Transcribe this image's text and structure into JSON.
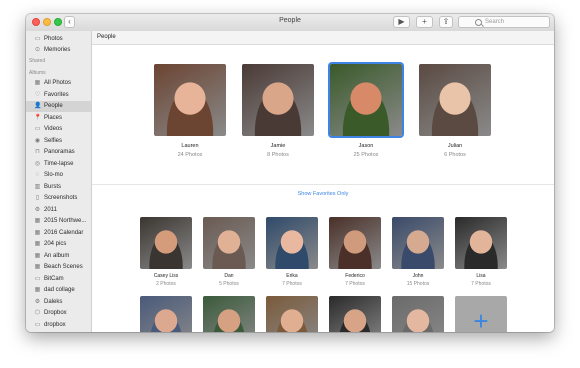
{
  "window": {
    "title": "People"
  },
  "toolbar": {
    "back": "‹",
    "play": "▶",
    "add": "+",
    "share": "⇪",
    "search_placeholder": "Search"
  },
  "sidebar": {
    "top": [
      {
        "label": "Photos",
        "icon": "photos-icon",
        "glyph": "▭"
      },
      {
        "label": "Memories",
        "icon": "memories-icon",
        "glyph": "⊙"
      }
    ],
    "shared_heading": "Shared",
    "albums_heading": "Albums",
    "albums": [
      {
        "label": "All Photos",
        "icon": "album-icon",
        "glyph": "▦"
      },
      {
        "label": "Favorites",
        "icon": "heart-icon",
        "glyph": "♡"
      },
      {
        "label": "People",
        "icon": "person-icon",
        "glyph": "👤",
        "selected": true
      },
      {
        "label": "Places",
        "icon": "pin-icon",
        "glyph": "📍"
      },
      {
        "label": "Videos",
        "icon": "video-icon",
        "glyph": "▭"
      },
      {
        "label": "Selfies",
        "icon": "selfie-icon",
        "glyph": "◉"
      },
      {
        "label": "Panoramas",
        "icon": "panorama-icon",
        "glyph": "⊓"
      },
      {
        "label": "Time-lapse",
        "icon": "timelapse-icon",
        "glyph": "◎"
      },
      {
        "label": "Slo-mo",
        "icon": "slomo-icon",
        "glyph": "◌"
      },
      {
        "label": "Bursts",
        "icon": "bursts-icon",
        "glyph": "▥"
      },
      {
        "label": "Screenshots",
        "icon": "screenshot-icon",
        "glyph": "▯"
      },
      {
        "label": "2011",
        "icon": "album-icon",
        "glyph": "⚙"
      },
      {
        "label": "2015 Northwe...",
        "icon": "album-icon",
        "glyph": "▦"
      },
      {
        "label": "2016 Calendar",
        "icon": "album-icon",
        "glyph": "▦"
      },
      {
        "label": "204 pics",
        "icon": "album-icon",
        "glyph": "▦"
      },
      {
        "label": "An album",
        "icon": "album-icon",
        "glyph": "▦"
      },
      {
        "label": "Beach Scenes",
        "icon": "album-icon",
        "glyph": "▦"
      },
      {
        "label": "BitCam",
        "icon": "album-icon",
        "glyph": "▭"
      },
      {
        "label": "dad collage",
        "icon": "album-icon",
        "glyph": "▦"
      },
      {
        "label": "Daleks",
        "icon": "album-icon",
        "glyph": "⚙"
      },
      {
        "label": "Dropbox",
        "icon": "dropbox-icon",
        "glyph": "⬡"
      },
      {
        "label": "dropbox",
        "icon": "album-icon",
        "glyph": "▭"
      }
    ]
  },
  "main": {
    "header": "People",
    "favorites": [
      {
        "name": "Lauren",
        "count": "24 Photos",
        "c1": "#6b4432",
        "c2": "#e7b49a"
      },
      {
        "name": "Jamie",
        "count": "8 Photos",
        "c1": "#4a3a36",
        "c2": "#d9a68a"
      },
      {
        "name": "Jason",
        "count": "25 Photos",
        "c1": "#3a5a2a",
        "c2": "#d88a68",
        "selected": true
      },
      {
        "name": "Julian",
        "count": "6 Photos",
        "c1": "#5a4a42",
        "c2": "#e9c4a8"
      }
    ],
    "show_favorites_link": "Show Favorites Only",
    "people_row1": [
      {
        "name": "Casey Liss",
        "count": "2 Photos",
        "c1": "#3a3530",
        "c2": "#d59c7c"
      },
      {
        "name": "Dan",
        "count": "5 Photos",
        "c1": "#6a5a52",
        "c2": "#e1b196"
      },
      {
        "name": "Erika",
        "count": "7 Photos",
        "c1": "#2f4a6a",
        "c2": "#e8b8a0"
      },
      {
        "name": "Federico",
        "count": "7 Photos",
        "c1": "#4a3028",
        "c2": "#d09a7c"
      },
      {
        "name": "John",
        "count": "15 Photos",
        "c1": "#3a4a6a",
        "c2": "#d6aa90"
      },
      {
        "name": "Lisa",
        "count": "7 Photos",
        "c1": "#2a2a2a",
        "c2": "#e2b49a"
      }
    ],
    "people_row2": [
      {
        "c1": "#4a5a7a",
        "c2": "#dca890"
      },
      {
        "c1": "#3a5a3a",
        "c2": "#d6a082"
      },
      {
        "c1": "#7a5a3a",
        "c2": "#e0ae90"
      },
      {
        "c1": "#2a2a2a",
        "c2": "#d8a488"
      },
      {
        "c1": "#6a6a6a",
        "c2": "#e4b8a0"
      }
    ],
    "add_glyph": "+"
  }
}
